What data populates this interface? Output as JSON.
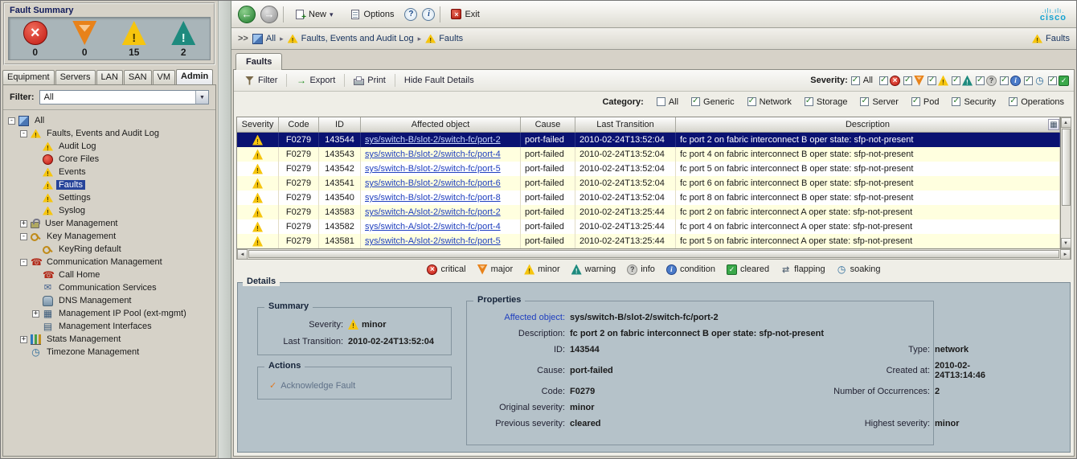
{
  "colors": {
    "selected_row_bg": "#0a1272",
    "link_blue": "#1f3fbf",
    "details_bg": "#b5c2c9",
    "minor_yellow": "#f6c50e",
    "warning_teal": "#1e8a7e",
    "critical_red": "#c01810",
    "major_orange": "#e8821a",
    "cleared_green": "#3aa84a"
  },
  "fault_summary": {
    "title": "Fault Summary",
    "items": [
      {
        "name": "critical",
        "count": "0"
      },
      {
        "name": "major",
        "count": "0"
      },
      {
        "name": "minor",
        "count": "15"
      },
      {
        "name": "warning",
        "count": "2"
      }
    ]
  },
  "nav_tabs": {
    "items": [
      {
        "label": "Equipment",
        "active": false
      },
      {
        "label": "Servers",
        "active": false
      },
      {
        "label": "LAN",
        "active": false
      },
      {
        "label": "SAN",
        "active": false
      },
      {
        "label": "VM",
        "active": false
      },
      {
        "label": "Admin",
        "active": true
      }
    ]
  },
  "filter": {
    "label": "Filter:",
    "value": "All"
  },
  "tree": {
    "items": [
      {
        "label": "All",
        "level": 0,
        "expander": "-",
        "icon": "computers",
        "selected": false
      },
      {
        "label": "Faults, Events and Audit Log",
        "level": 1,
        "expander": "-",
        "icon": "fault",
        "selected": false
      },
      {
        "label": "Audit Log",
        "level": 2,
        "expander": "",
        "icon": "audit",
        "selected": false
      },
      {
        "label": "Core Files",
        "level": 2,
        "expander": "",
        "icon": "core",
        "selected": false
      },
      {
        "label": "Events",
        "level": 2,
        "expander": "",
        "icon": "events",
        "selected": false
      },
      {
        "label": "Faults",
        "level": 2,
        "expander": "",
        "icon": "faults",
        "selected": true
      },
      {
        "label": "Settings",
        "level": 2,
        "expander": "",
        "icon": "settings",
        "selected": false
      },
      {
        "label": "Syslog",
        "level": 2,
        "expander": "",
        "icon": "syslog",
        "selected": false
      },
      {
        "label": "User Management",
        "level": 1,
        "expander": "+",
        "icon": "lock",
        "selected": false
      },
      {
        "label": "Key Management",
        "level": 1,
        "expander": "-",
        "icon": "key",
        "selected": false
      },
      {
        "label": "KeyRing default",
        "level": 2,
        "expander": "",
        "icon": "keyring",
        "selected": false
      },
      {
        "label": "Communication Management",
        "level": 1,
        "expander": "-",
        "icon": "comm",
        "selected": false
      },
      {
        "label": "Call Home",
        "level": 2,
        "expander": "",
        "icon": "callhome",
        "selected": false
      },
      {
        "label": "Communication Services",
        "level": 2,
        "expander": "",
        "icon": "services",
        "selected": false
      },
      {
        "label": "DNS Management",
        "level": 2,
        "expander": "",
        "icon": "dns",
        "selected": false
      },
      {
        "label": "Management IP Pool (ext-mgmt)",
        "level": 2,
        "expander": "+",
        "icon": "ippool",
        "selected": false
      },
      {
        "label": "Management Interfaces",
        "level": 2,
        "expander": "",
        "icon": "interfaces",
        "selected": false
      },
      {
        "label": "Stats Management",
        "level": 1,
        "expander": "+",
        "icon": "stats",
        "selected": false
      },
      {
        "label": "Timezone Management",
        "level": 1,
        "expander": "",
        "icon": "timezone",
        "selected": false
      }
    ]
  },
  "toolbar": {
    "new_label": "New",
    "options_label": "Options",
    "exit_label": "Exit",
    "brand": "cisco",
    "brand_bars": ".ılı.ılı."
  },
  "breadcrumb": {
    "prefix": ">>",
    "items": [
      {
        "label": "All",
        "icon": "computers"
      },
      {
        "label": "Faults, Events and Audit Log",
        "icon": "fault"
      },
      {
        "label": "Faults",
        "icon": "fault"
      }
    ],
    "right": "Faults"
  },
  "content_tab": {
    "label": "Faults"
  },
  "table_toolbar": {
    "buttons": [
      {
        "label": "Filter",
        "icon": "filter"
      },
      {
        "label": "Export",
        "icon": "export"
      },
      {
        "label": "Print",
        "icon": "print"
      },
      {
        "label": "Hide Fault Details",
        "icon": ""
      }
    ],
    "severity": {
      "label": "Severity:",
      "all_label": "All",
      "icons": [
        "critical",
        "major",
        "minor",
        "warning",
        "info",
        "condition",
        "soaking",
        "cleared"
      ]
    }
  },
  "category": {
    "label": "Category:",
    "options": [
      {
        "label": "All",
        "checked": false
      },
      {
        "label": "Generic",
        "checked": true
      },
      {
        "label": "Network",
        "checked": true
      },
      {
        "label": "Storage",
        "checked": true
      },
      {
        "label": "Server",
        "checked": true
      },
      {
        "label": "Pod",
        "checked": true
      },
      {
        "label": "Security",
        "checked": true
      },
      {
        "label": "Operations",
        "checked": true
      }
    ]
  },
  "table": {
    "columns": [
      "Severity",
      "Code",
      "ID",
      "Affected object",
      "Cause",
      "Last Transition",
      "Description"
    ],
    "rows": [
      {
        "severity": "minor",
        "code": "F0279",
        "id": "143544",
        "affected": "sys/switch-B/slot-2/switch-fc/port-2",
        "cause": "port-failed",
        "last_transition": "2010-02-24T13:52:04",
        "description": "fc port 2 on fabric interconnect B oper state: sfp-not-present",
        "selected": true
      },
      {
        "severity": "minor",
        "code": "F0279",
        "id": "143543",
        "affected": "sys/switch-B/slot-2/switch-fc/port-4",
        "cause": "port-failed",
        "last_transition": "2010-02-24T13:52:04",
        "description": "fc port 4 on fabric interconnect B oper state: sfp-not-present",
        "selected": false
      },
      {
        "severity": "minor",
        "code": "F0279",
        "id": "143542",
        "affected": "sys/switch-B/slot-2/switch-fc/port-5",
        "cause": "port-failed",
        "last_transition": "2010-02-24T13:52:04",
        "description": "fc port 5 on fabric interconnect B oper state: sfp-not-present",
        "selected": false
      },
      {
        "severity": "minor",
        "code": "F0279",
        "id": "143541",
        "affected": "sys/switch-B/slot-2/switch-fc/port-6",
        "cause": "port-failed",
        "last_transition": "2010-02-24T13:52:04",
        "description": "fc port 6 on fabric interconnect B oper state: sfp-not-present",
        "selected": false
      },
      {
        "severity": "minor",
        "code": "F0279",
        "id": "143540",
        "affected": "sys/switch-B/slot-2/switch-fc/port-8",
        "cause": "port-failed",
        "last_transition": "2010-02-24T13:52:04",
        "description": "fc port 8 on fabric interconnect B oper state: sfp-not-present",
        "selected": false
      },
      {
        "severity": "minor",
        "code": "F0279",
        "id": "143583",
        "affected": "sys/switch-A/slot-2/switch-fc/port-2",
        "cause": "port-failed",
        "last_transition": "2010-02-24T13:25:44",
        "description": "fc port 2 on fabric interconnect A oper state: sfp-not-present",
        "selected": false
      },
      {
        "severity": "minor",
        "code": "F0279",
        "id": "143582",
        "affected": "sys/switch-A/slot-2/switch-fc/port-4",
        "cause": "port-failed",
        "last_transition": "2010-02-24T13:25:44",
        "description": "fc port 4 on fabric interconnect A oper state: sfp-not-present",
        "selected": false
      },
      {
        "severity": "minor",
        "code": "F0279",
        "id": "143581",
        "affected": "sys/switch-A/slot-2/switch-fc/port-5",
        "cause": "port-failed",
        "last_transition": "2010-02-24T13:25:44",
        "description": "fc port 5 on fabric interconnect A oper state: sfp-not-present",
        "selected": false
      }
    ]
  },
  "legend": {
    "items": [
      "critical",
      "major",
      "minor",
      "warning",
      "info",
      "condition",
      "cleared",
      "flapping",
      "soaking"
    ]
  },
  "details": {
    "title": "Details",
    "summary": {
      "title": "Summary",
      "severity_label": "Severity:",
      "severity_value": "minor",
      "last_transition_label": "Last Transition:",
      "last_transition_value": "2010-02-24T13:52:04"
    },
    "actions": {
      "title": "Actions",
      "acknowledge": "Acknowledge Fault"
    },
    "properties": {
      "title": "Properties",
      "affected_label": "Affected object:",
      "affected_value": "sys/switch-B/slot-2/switch-fc/port-2",
      "description_label": "Description:",
      "description_value": "fc port 2 on fabric interconnect B oper state: sfp-not-present",
      "id_label": "ID:",
      "id_value": "143544",
      "type_label": "Type:",
      "type_value": "network",
      "cause_label": "Cause:",
      "cause_value": "port-failed",
      "created_label": "Created at:",
      "created_value": "2010-02-24T13:14:46",
      "code_label": "Code:",
      "code_value": "F0279",
      "occurrences_label": "Number of Occurrences:",
      "occurrences_value": "2",
      "original_label": "Original severity:",
      "original_value": "minor",
      "previous_label": "Previous severity:",
      "previous_value": "cleared",
      "highest_label": "Highest severity:",
      "highest_value": "minor"
    }
  }
}
